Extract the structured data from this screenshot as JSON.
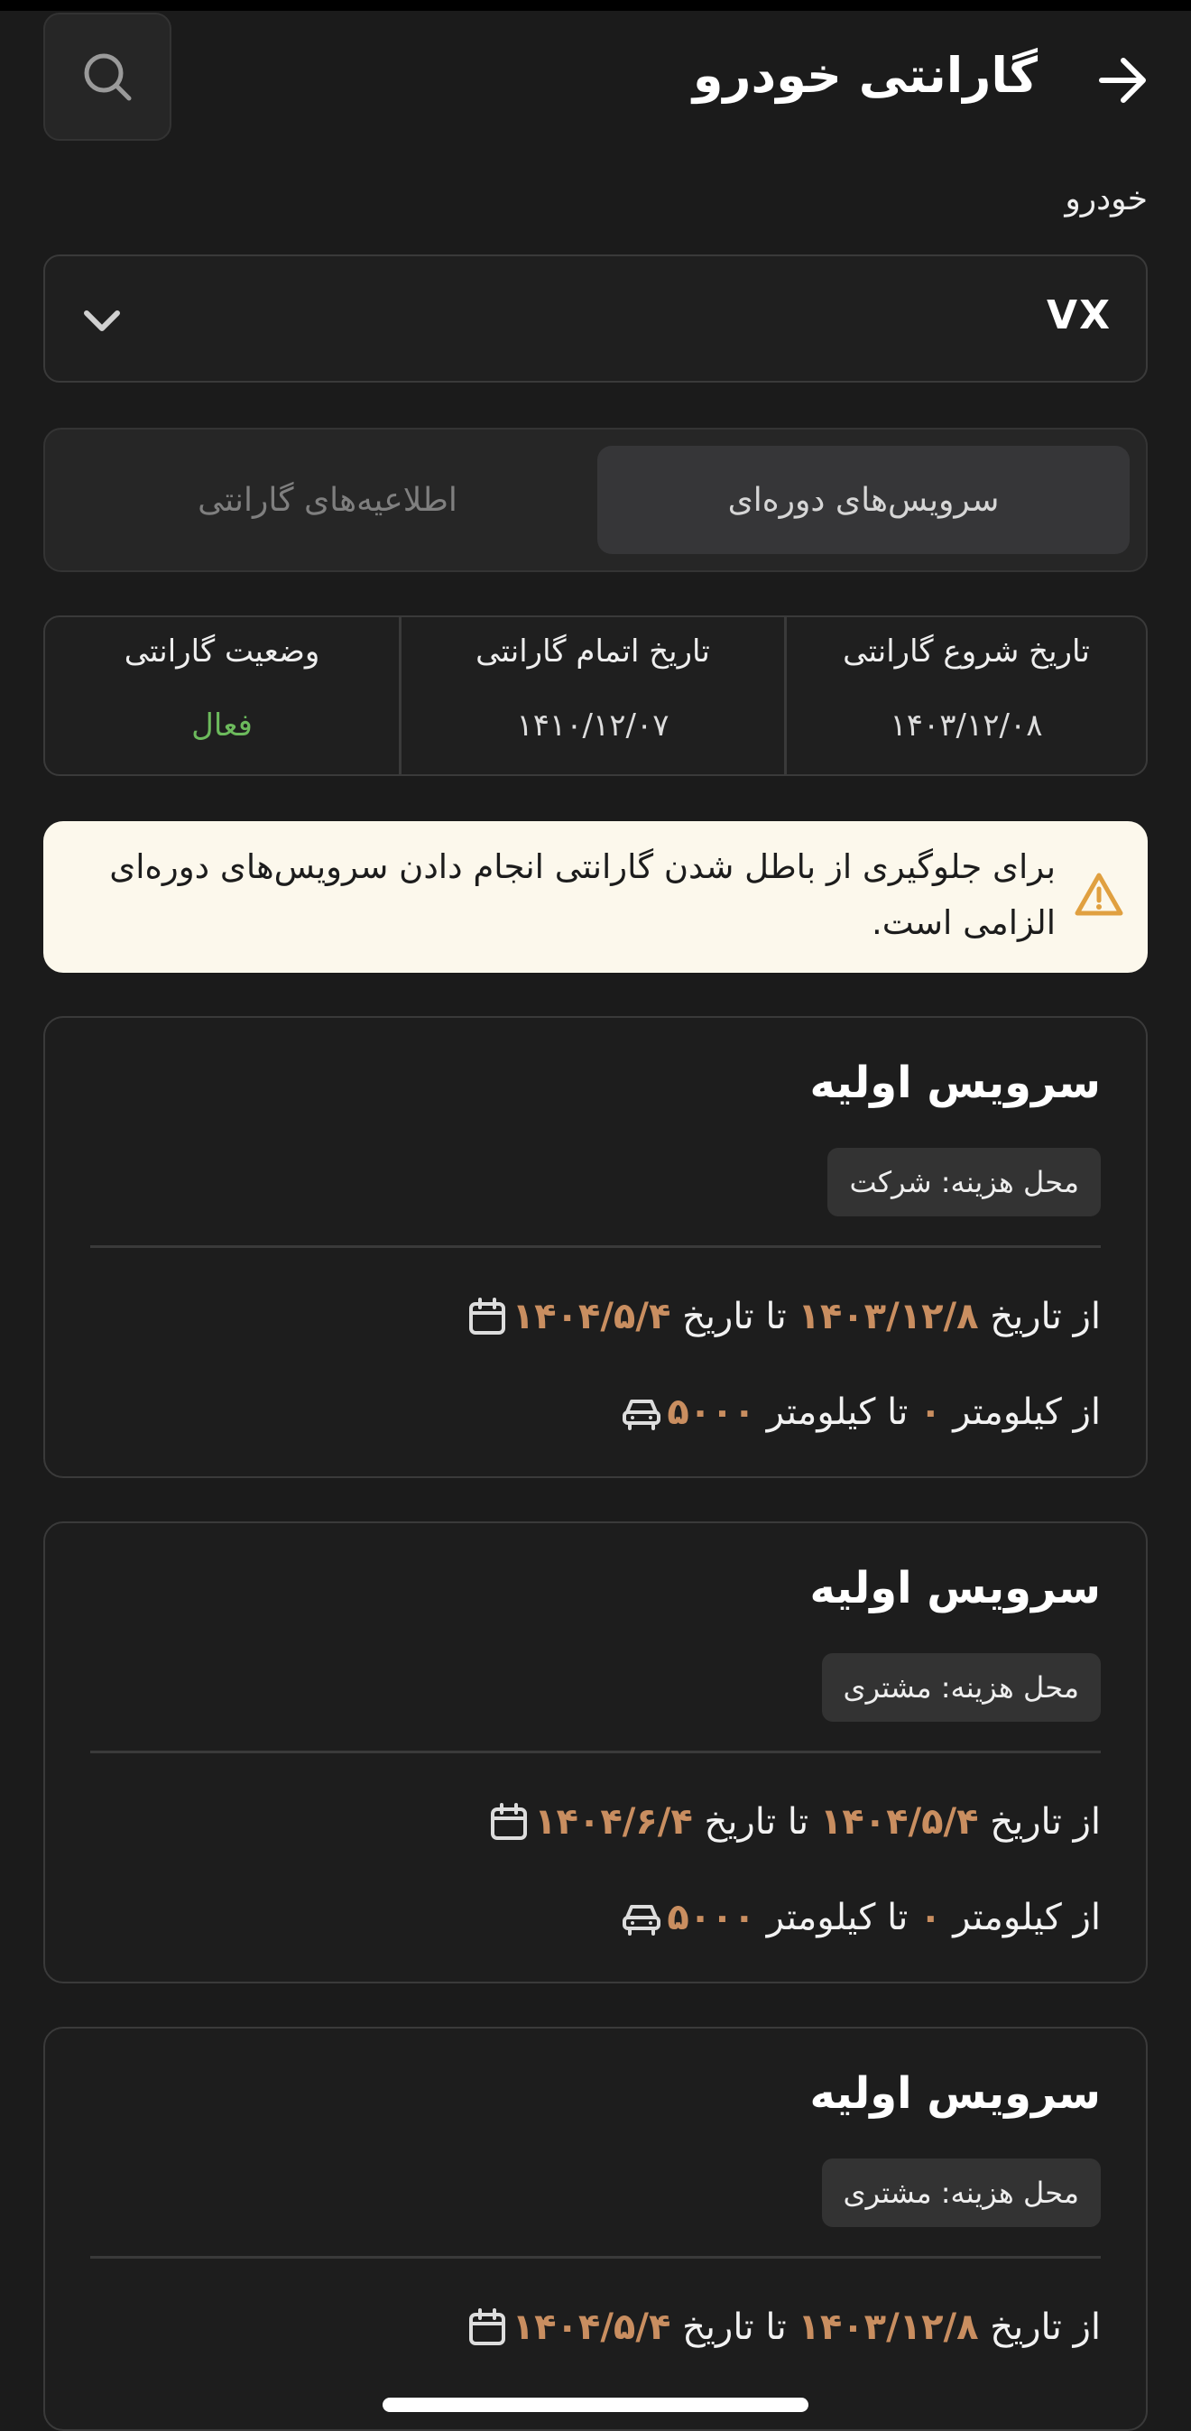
{
  "header": {
    "title": "گارانتی خودرو",
    "back_icon": "arrow-right-icon",
    "search_icon": "search-icon"
  },
  "vehicle": {
    "label": "خودرو",
    "value": "VX"
  },
  "tabs": [
    {
      "label": "سرویس‌های دوره‌ای",
      "active": true
    },
    {
      "label": "اطلاعیه‌های گارانتی",
      "active": false
    }
  ],
  "warranty": {
    "start_label": "تاریخ شروع گارانتی",
    "start_value": "۱۴۰۳/۱۲/۰۸",
    "end_label": "تاریخ اتمام گارانتی",
    "end_value": "۱۴۱۰/۱۲/۰۷",
    "status_label": "وضعیت گارانتی",
    "status_value": "فعال"
  },
  "alert": {
    "text": "برای جلوگیری از باطل شدن گارانتی انجام دادن سرویس‌های دوره‌ای الزامی است."
  },
  "labels": {
    "from_date": "از تاریخ",
    "to_date": "تا تاریخ",
    "from_km": "از کیلومتر",
    "to_km": "تا کیلومتر"
  },
  "services": [
    {
      "title": "سرویس اولیه",
      "badge": "محل هزینه: شرکت",
      "date_from": "۱۴۰۳/۱۲/۸",
      "date_to": "۱۴۰۴/۵/۴",
      "km_from": "۰",
      "km_to": "۵۰۰۰"
    },
    {
      "title": "سرویس اولیه",
      "badge": "محل هزینه: مشتری",
      "date_from": "۱۴۰۴/۵/۴",
      "date_to": "۱۴۰۴/۶/۴",
      "km_from": "۰",
      "km_to": "۵۰۰۰"
    },
    {
      "title": "سرویس اولیه",
      "badge": "محل هزینه: مشتری",
      "date_from": "۱۴۰۳/۱۲/۸",
      "date_to": "۱۴۰۴/۵/۴"
    }
  ],
  "colors": {
    "background": "#1b1b1b",
    "highlight": "#c98e60",
    "active_status": "#6cba5c",
    "alert_bg": "#fcf8ec",
    "warning": "#e0a040"
  }
}
